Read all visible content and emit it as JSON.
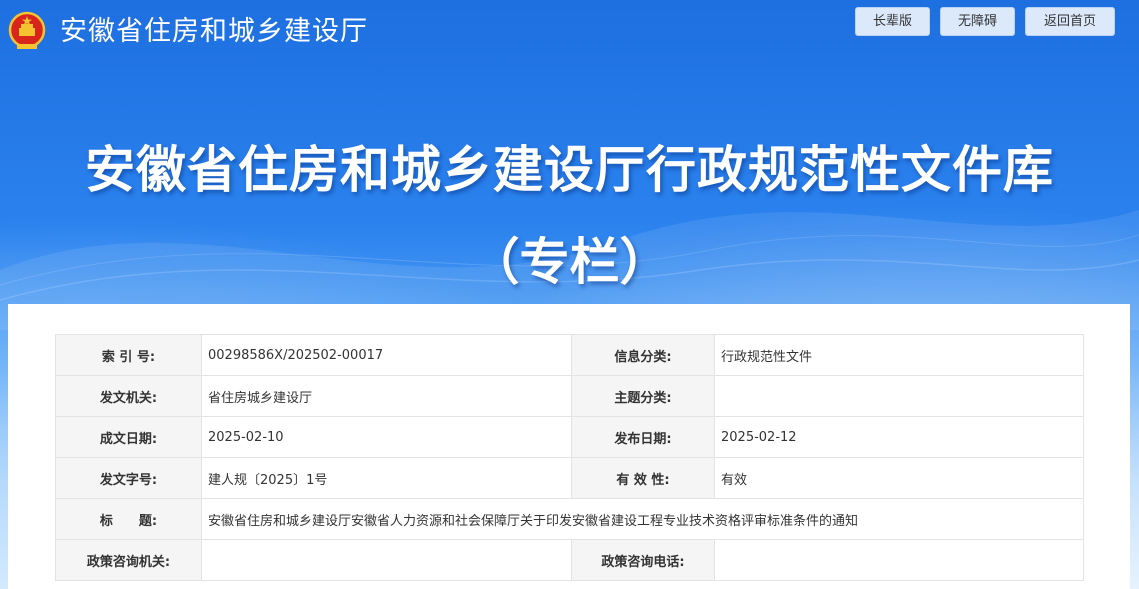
{
  "header": {
    "site_name": "安徽省住房和城乡建设厅",
    "buttons": [
      "长辈版",
      "无障碍",
      "返回首页"
    ]
  },
  "hero": {
    "title": "安徽省住房和城乡建设厅行政规范性文件库",
    "subtitle": "（专栏）"
  },
  "colors": {
    "banner_blue": "#2b82ee",
    "label_bg": "#f5f5f5",
    "border": "#e3e3e3",
    "button_bg": "#dbe9fb"
  },
  "icons": {
    "emblem": "national-emblem-icon"
  },
  "meta_table": {
    "rows": [
      {
        "l1": "索 引 号:",
        "v1": "00298586X/202502-00017",
        "l2": "信息分类:",
        "v2": "行政规范性文件"
      },
      {
        "l1": "发文机关:",
        "v1": "省住房城乡建设厅",
        "l2": "主题分类:",
        "v2": ""
      },
      {
        "l1": "成文日期:",
        "v1": "2025-02-10",
        "l2": "发布日期:",
        "v2": "2025-02-12"
      },
      {
        "l1": "发文字号:",
        "v1": "建人规〔2025〕1号",
        "l2": "有 效 性:",
        "v2": "有效"
      }
    ],
    "title_row": {
      "label": "标　　题:",
      "value": "安徽省住房和城乡建设厅安徽省人力资源和社会保障厅关于印发安徽省建设工程专业技术资格评审标准条件的通知"
    },
    "consult_row": {
      "l1": "政策咨询机关:",
      "v1": "",
      "l2": "政策咨询电话:",
      "v2": ""
    }
  }
}
